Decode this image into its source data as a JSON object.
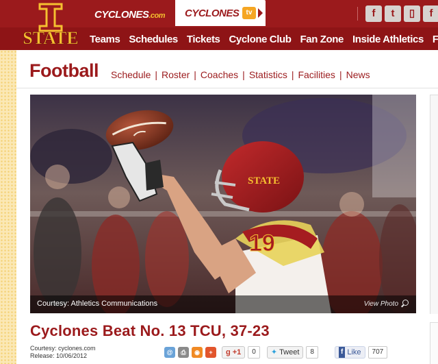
{
  "header": {
    "logo_text": "STATE",
    "tabs": [
      {
        "label": "CYCLONES",
        "suffix": ".com"
      },
      {
        "label": "CYCLONES",
        "badge": "tv"
      }
    ],
    "social_icons": [
      "flickr-icon",
      "twitter-icon",
      "mobile-icon",
      "facebook-icon"
    ],
    "social_glyphs": [
      "f",
      "t",
      "▯",
      "f"
    ],
    "nav": [
      "Teams",
      "Schedules",
      "Tickets",
      "Cyclone Club",
      "Fan Zone",
      "Inside Athletics",
      "Facilities"
    ]
  },
  "section": {
    "title": "Football",
    "subnav": [
      "Schedule",
      "Roster",
      "Coaches",
      "Statistics",
      "Facilities",
      "News"
    ]
  },
  "photo": {
    "caption": "Courtesy: Athletics Communications",
    "view_label": "View Photo",
    "jersey_number": "19",
    "helmet_text": "STATE"
  },
  "article": {
    "headline": "Cyclones Beat No. 13 TCU, 37-23",
    "courtesy": "Courtesy: cyclones.com",
    "release": "Release: 10/06/2012"
  },
  "share": {
    "gplus_label": "+1",
    "gplus_count": "0",
    "tweet_label": "Tweet",
    "tweet_count": "8",
    "like_label": "Like",
    "like_count": "707"
  },
  "colors": {
    "brand_cardinal": "#9b1a1c",
    "brand_gold": "#f5c030"
  }
}
